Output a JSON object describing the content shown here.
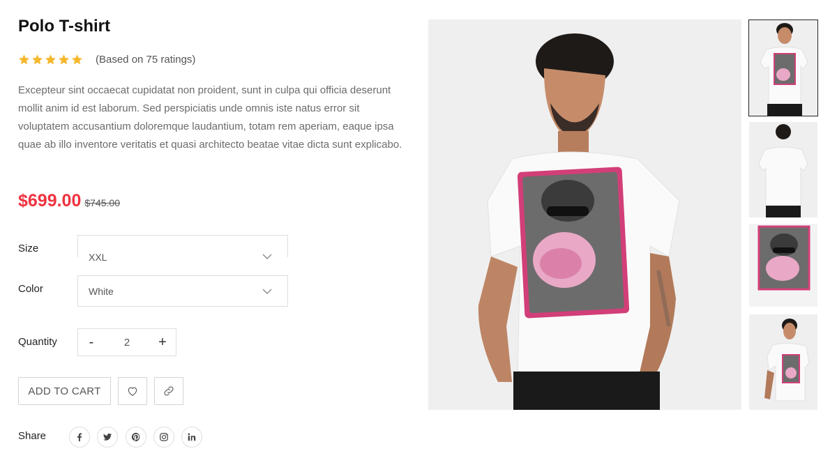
{
  "product": {
    "title": "Polo T-shirt",
    "rating_stars": 5,
    "rating_text": "(Based on 75 ratings)",
    "description": "Excepteur sint occaecat cupidatat non proident, sunt in culpa qui officia deserunt mollit anim id est laborum. Sed perspiciatis unde omnis iste natus error sit voluptatem accusantium doloremque laudantium, totam rem aperiam, eaque ipsa quae ab illo inventore veritatis et quasi architecto beatae vitae dicta sunt explicabo.",
    "price": "$699.00",
    "old_price": "$745.00"
  },
  "options": {
    "size_label": "Size",
    "size_value": "XXL",
    "color_label": "Color",
    "color_value": "White",
    "quantity_label": "Quantity",
    "quantity_minus": "-",
    "quantity_value": "2",
    "quantity_plus": "+"
  },
  "actions": {
    "add_to_cart": "ADD TO CART",
    "wishlist_icon": "heart-icon",
    "link_icon": "link-icon"
  },
  "share": {
    "label": "Share",
    "networks": [
      "facebook-icon",
      "twitter-icon",
      "pinterest-icon",
      "instagram-icon",
      "linkedin-icon"
    ]
  },
  "gallery": {
    "thumbnails": [
      "front-view",
      "back-view",
      "print-detail",
      "side-view"
    ],
    "active_thumbnail": 0
  },
  "colors": {
    "price": "#ef3340",
    "star": "#f5b82e",
    "text_muted": "#6b6b6b",
    "image_bg": "#efefef",
    "print_pink": "#d23f78"
  }
}
